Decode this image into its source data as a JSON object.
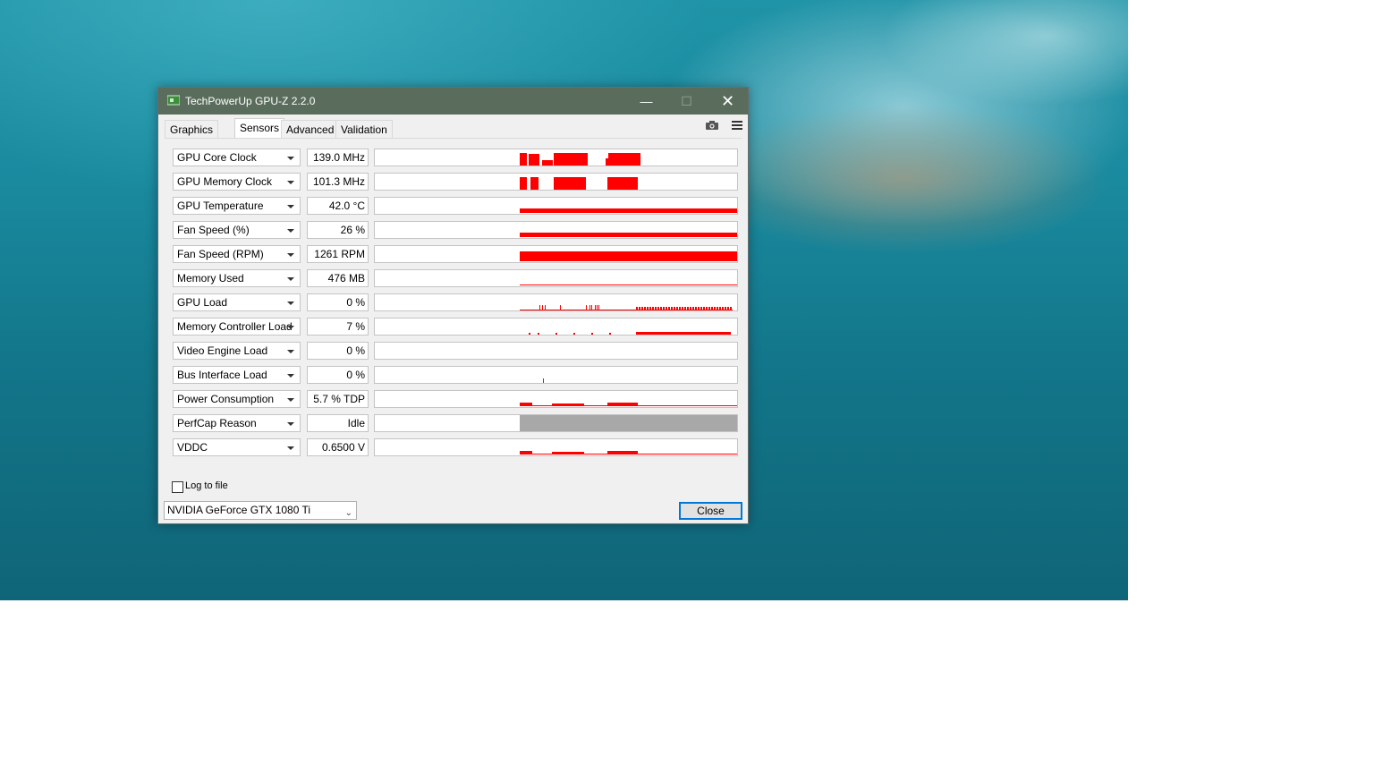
{
  "window": {
    "title": "TechPowerUp GPU-Z 2.2.0",
    "minimize_glyph": "—",
    "maximize_glyph": "☐",
    "close_glyph": "✕"
  },
  "tabs": [
    {
      "label": "Graphics Card",
      "active": false
    },
    {
      "label": "Sensors",
      "active": true
    },
    {
      "label": "Advanced",
      "active": false
    },
    {
      "label": "Validation",
      "active": false
    }
  ],
  "toolbar": {
    "camera_icon": "camera-icon",
    "menu_icon": "hamburger-menu-icon"
  },
  "sensors": [
    {
      "name": "GPU Core Clock",
      "value": "139.0 MHz",
      "graph": "block"
    },
    {
      "name": "GPU Memory Clock",
      "value": "101.3 MHz",
      "graph": "block"
    },
    {
      "name": "GPU Temperature",
      "value": "42.0 °C",
      "graph": "level"
    },
    {
      "name": "Fan Speed (%)",
      "value": "26 %",
      "graph": "level"
    },
    {
      "name": "Fan Speed (RPM)",
      "value": "1261 RPM",
      "graph": "level"
    },
    {
      "name": "Memory Used",
      "value": "476 MB",
      "graph": "level"
    },
    {
      "name": "GPU Load",
      "value": "0 %",
      "graph": "spikes"
    },
    {
      "name": "Memory Controller Load",
      "value": "7 %",
      "graph": "spikes"
    },
    {
      "name": "Video Engine Load",
      "value": "0 %",
      "graph": "empty"
    },
    {
      "name": "Bus Interface Load",
      "value": "0 %",
      "graph": "spikes"
    },
    {
      "name": "Power Consumption",
      "value": "5.7 % TDP",
      "graph": "level"
    },
    {
      "name": "PerfCap Reason",
      "value": "Idle",
      "graph": "perfcap"
    },
    {
      "name": "VDDC",
      "value": "0.6500 V",
      "graph": "level"
    }
  ],
  "log_to_file": {
    "label": "Log to file",
    "checked": false
  },
  "gpu_select": {
    "value": "NVIDIA GeForce GTX 1080 Ti"
  },
  "close_button": {
    "label": "Close"
  },
  "colors": {
    "graph": "#ff0000",
    "perfcap": "#a8a8a8",
    "titlebar": "#5a6d5c"
  }
}
